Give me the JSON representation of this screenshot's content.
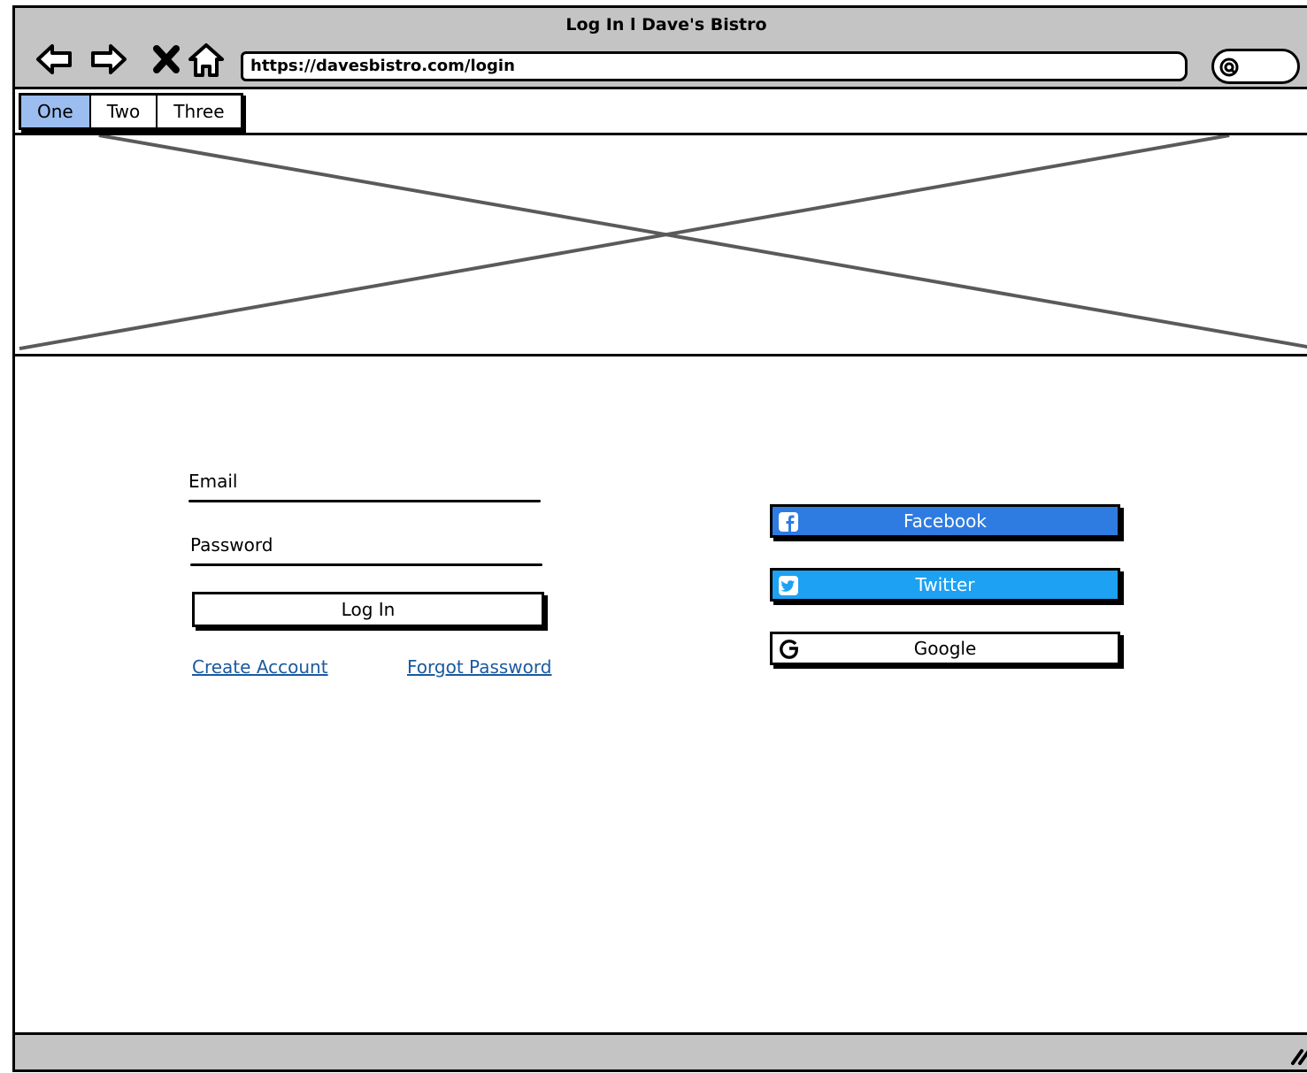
{
  "window": {
    "title": "Log In l Dave's Bistro"
  },
  "toolbar": {
    "back_icon": "back-arrow-icon",
    "forward_icon": "forward-arrow-icon",
    "stop_icon": "close-icon",
    "home_icon": "home-icon",
    "url": "https://davesbistro.com/login",
    "search_icon": "search-icon"
  },
  "tabs": [
    {
      "label": "One",
      "active": true
    },
    {
      "label": "Two",
      "active": false
    },
    {
      "label": "Three",
      "active": false
    }
  ],
  "hero": {
    "kind": "image-placeholder"
  },
  "login_form": {
    "email_label": "Email",
    "password_label": "Password",
    "login_button": "Log In",
    "create_account_link": "Create Account",
    "forgot_password_link": "Forgot Password"
  },
  "social_login": {
    "facebook": {
      "label": "Facebook",
      "icon": "facebook-icon",
      "color": "#2e7be2"
    },
    "twitter": {
      "label": "Twitter",
      "icon": "twitter-icon",
      "color": "#1da1f2"
    },
    "google": {
      "label": "Google",
      "icon": "google-icon",
      "color": "#ffffff"
    }
  },
  "colors": {
    "chrome": "#c4c4c4",
    "active_tab": "#9bbdf0",
    "link": "#1a5aa0"
  }
}
